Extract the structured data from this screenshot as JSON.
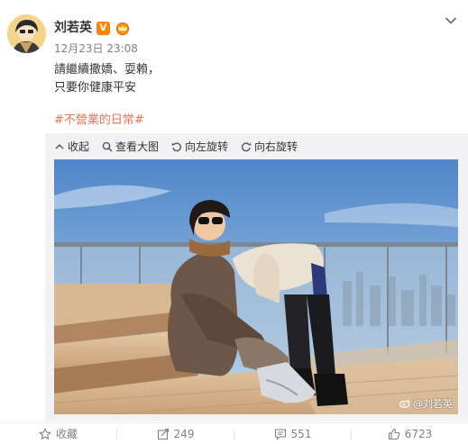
{
  "user": {
    "name": "刘若英",
    "vip_badge": "V"
  },
  "post": {
    "timestamp": "12月23日 23:08",
    "text": "請繼續撒嬌、耍賴，\n只要你健康平安",
    "hashtag": "#不營業的日常#"
  },
  "media_toolbar": {
    "collapse_label": "收起",
    "view_large_label": "查看大图",
    "rotate_left_label": "向左旋转",
    "rotate_right_label": "向右旋转"
  },
  "photo": {
    "watermark": "@刘若英"
  },
  "actions": {
    "favorite_label": "收藏",
    "repost_count": "249",
    "comment_count": "551",
    "like_count": "6723"
  },
  "colors": {
    "accent": "#eb7350",
    "vip": "#ff8200",
    "muted": "#808080"
  }
}
